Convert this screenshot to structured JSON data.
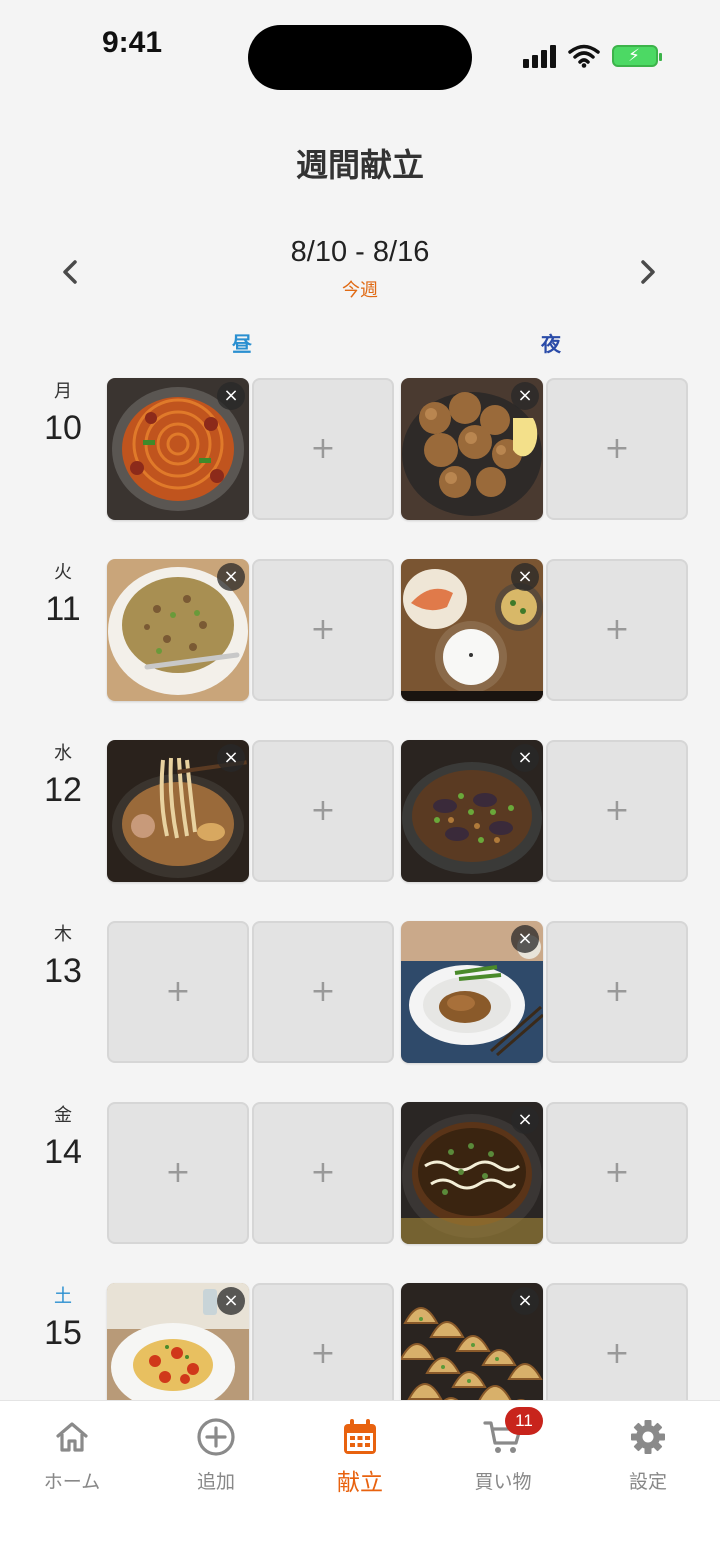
{
  "status_bar": {
    "time": "9:41"
  },
  "header": {
    "title": "週間献立"
  },
  "week_nav": {
    "prev_icon": "chevron-left-icon",
    "next_icon": "chevron-right-icon",
    "range": "8/10 - 8/16",
    "label": "今週"
  },
  "columns": {
    "lunch": "昼",
    "dinner": "夜"
  },
  "plus_symbol": "+",
  "remove_symbol": "×",
  "days": [
    {
      "name": "月",
      "num": "10",
      "saturday": false,
      "slots": [
        "napolitan",
        "empty",
        "karaage",
        "empty"
      ]
    },
    {
      "name": "火",
      "num": "11",
      "saturday": false,
      "slots": [
        "fried-rice",
        "empty",
        "salmon-set",
        "empty"
      ]
    },
    {
      "name": "水",
      "num": "12",
      "saturday": false,
      "slots": [
        "ramen",
        "empty",
        "eggplant-stirfry",
        "empty"
      ]
    },
    {
      "name": "木",
      "num": "13",
      "saturday": false,
      "slots": [
        "empty",
        "empty",
        "chicken-steak",
        "empty"
      ]
    },
    {
      "name": "金",
      "num": "14",
      "saturday": false,
      "slots": [
        "empty",
        "empty",
        "okonomiyaki",
        "empty"
      ]
    },
    {
      "name": "土",
      "num": "15",
      "saturday": true,
      "slots": [
        "tomato-egg",
        "empty",
        "gyoza",
        "empty"
      ]
    }
  ],
  "tabs": [
    {
      "label": "ホーム",
      "icon": "home-icon",
      "active": false
    },
    {
      "label": "追加",
      "icon": "plus-circle-icon",
      "active": false
    },
    {
      "label": "献立",
      "icon": "calendar-icon",
      "active": true
    },
    {
      "label": "買い物",
      "icon": "cart-icon",
      "active": false,
      "badge": "11"
    },
    {
      "label": "設定",
      "icon": "gear-icon",
      "active": false
    }
  ],
  "colors": {
    "accent": "#e8620f",
    "saturday": "#2a8fd0",
    "lunch": "#2a8fd0",
    "dinner": "#2a4ba8",
    "badge": "#c8241c"
  }
}
